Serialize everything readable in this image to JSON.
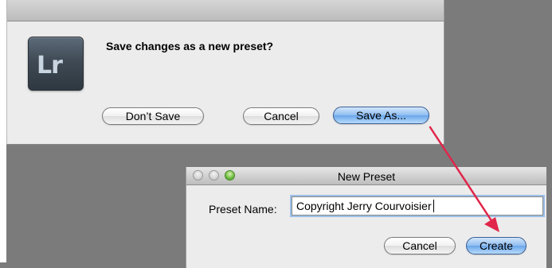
{
  "save_dialog": {
    "icon_text": "Lr",
    "message": "Save changes as a new preset?",
    "dont_save_label": "Don’t Save",
    "cancel_label": "Cancel",
    "save_as_label": "Save As..."
  },
  "preset_window": {
    "title": "New Preset",
    "name_label": "Preset Name:",
    "name_value": "Copyright Jerry Courvoisier",
    "cancel_label": "Cancel",
    "create_label": "Create"
  },
  "annotation": {
    "arrow_color": "#e0264a"
  }
}
